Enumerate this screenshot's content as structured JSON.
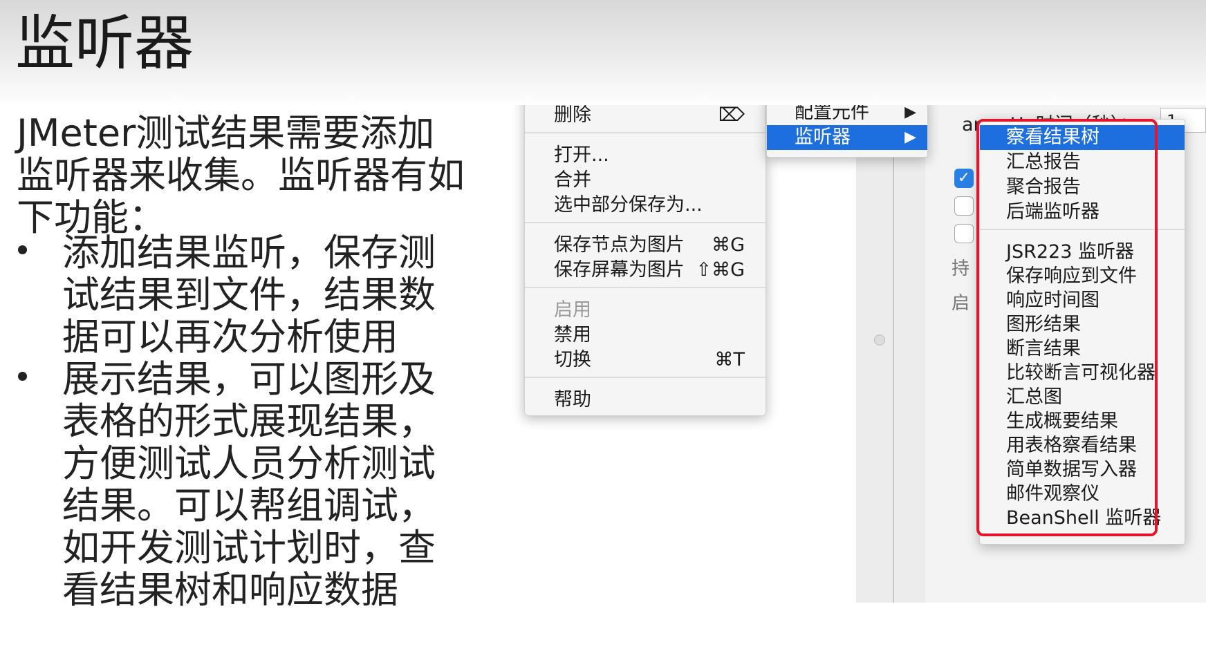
{
  "slide": {
    "title": "监听器",
    "intro": "JMeter测试结果需要添加监听器来收集。监听器有如下功能：",
    "bullets": [
      "添加结果监听，保存测试结果到文件，结果数据可以再次分析使用",
      "展示结果，可以图形及表格的形式展现结果，方便测试人员分析测试结果。可以帮组调试，如开发测试计划时，查看结果树和响应数据"
    ]
  },
  "background_panel": {
    "field_label": "amp-Up时间（秒）：",
    "field_value": "1",
    "char_1": "持",
    "char_2": "启"
  },
  "context_menu": {
    "items": [
      {
        "label": "删除",
        "shortcut": "⌦"
      },
      {
        "label": "打开..."
      },
      {
        "label": "合并"
      },
      {
        "label": "选中部分保存为..."
      },
      {
        "label": "保存节点为图片",
        "shortcut": "⌘G"
      },
      {
        "label": "保存屏幕为图片",
        "shortcut": "⇧⌘G"
      },
      {
        "label": "启用",
        "disabled": true
      },
      {
        "label": "禁用"
      },
      {
        "label": "切换",
        "shortcut": "⌘T"
      },
      {
        "label": "帮助"
      }
    ]
  },
  "submenu_add": {
    "items": [
      {
        "label": "配置元件",
        "arrow": "▶"
      },
      {
        "label": "监听器",
        "arrow": "▶",
        "selected": true
      }
    ]
  },
  "submenu_listeners": {
    "items": [
      {
        "label": "察看结果树",
        "selected": true
      },
      {
        "label": "汇总报告"
      },
      {
        "label": "聚合报告"
      },
      {
        "label": "后端监听器"
      },
      {
        "label": "JSR223 监听器"
      },
      {
        "label": "保存响应到文件"
      },
      {
        "label": "响应时间图"
      },
      {
        "label": "图形结果"
      },
      {
        "label": "断言结果"
      },
      {
        "label": "比较断言可视化器"
      },
      {
        "label": "汇总图"
      },
      {
        "label": "生成概要结果"
      },
      {
        "label": "用表格察看结果"
      },
      {
        "label": "简单数据写入器"
      },
      {
        "label": "邮件观察仪"
      },
      {
        "label": "BeanShell 监听器"
      }
    ]
  },
  "colors": {
    "selection": "#1d6fe0",
    "highlight_border": "#e4152a",
    "checkbox": "#2a7fe6"
  }
}
